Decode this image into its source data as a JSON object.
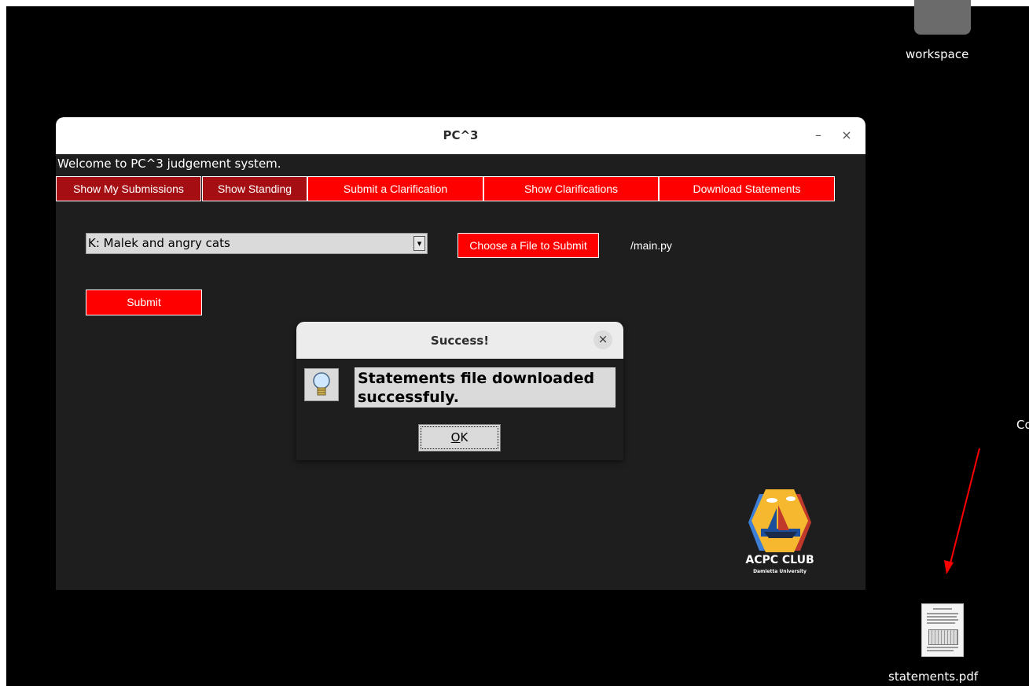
{
  "desktop": {
    "folder_label": "workspace",
    "pdf_label": "statements.pdf",
    "edge_text": "Co"
  },
  "window": {
    "title": "PC^3",
    "minimize_glyph": "–",
    "close_glyph": "×",
    "welcome": "Welcome to PC^3 judgement system.",
    "tabs": [
      {
        "label": "Show My Submissions"
      },
      {
        "label": "Show Standing"
      },
      {
        "label": "Submit a Clarification"
      },
      {
        "label": "Show Clarifications"
      },
      {
        "label": "Download Statements"
      }
    ],
    "problem_select": {
      "value": "K: Malek and angry cats"
    },
    "choose_file_label": "Choose a File to Submit",
    "file_path": "/main.py",
    "submit_label": "Submit",
    "logo": {
      "title": "ACPC CLUB",
      "subtitle": "Damietta University"
    }
  },
  "dialog": {
    "title": "Success!",
    "close_glyph": "×",
    "message": "Statements file downloaded successfuly.",
    "ok_label_underlined": "O",
    "ok_label_rest": "K"
  },
  "colors": {
    "accent_red": "#ff0000",
    "dark_red": "#a50f14",
    "annotation_arrow": "#ff0000"
  }
}
